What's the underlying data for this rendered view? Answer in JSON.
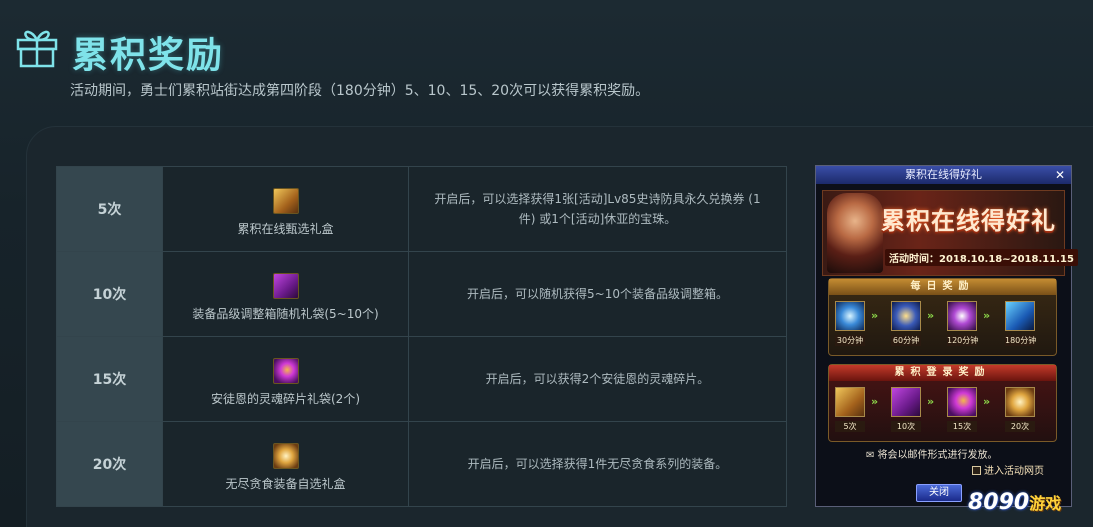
{
  "header": {
    "title": "累积奖励",
    "subtitle": "活动期间，勇士们累积站街达成第四阶段（180分钟）5、10、15、20次可以获得累积奖励。"
  },
  "rewards": [
    {
      "count": "5次",
      "item": "累积在线甄选礼盒",
      "desc": "开启后，可以选择获得1张[活动]Lv85史诗防具永久兑换券 (1件) 或1个[活动]休亚的宝珠。"
    },
    {
      "count": "10次",
      "item": "装备品级调整箱随机礼袋(5~10个)",
      "desc": "开启后，可以随机获得5~10个装备品级调整箱。"
    },
    {
      "count": "15次",
      "item": "安徒恩的灵魂碎片礼袋(2个)",
      "desc": "开启后，可以获得2个安徒恩的灵魂碎片。"
    },
    {
      "count": "20次",
      "item": "无尽贪食装备自选礼盒",
      "desc": "开启后，可以选择获得1件无尽贪食系列的装备。"
    }
  ],
  "popup": {
    "window_title": "累积在线得好礼",
    "close_glyph": "✕",
    "banner_title": "累积在线得好礼",
    "banner_date": "活动时间：2018.10.18~2018.11.15",
    "daily_head": "每日奖励",
    "daily_labels": [
      "30分钟",
      "60分钟",
      "120分钟",
      "180分钟"
    ],
    "cum_head": "累积登录奖励",
    "cum_labels": [
      "5次",
      "10次",
      "15次",
      "20次"
    ],
    "mail_text": "✉ 将会以邮件形式进行发放。",
    "enter_text": "进入活动网页",
    "close_button": "关闭"
  },
  "watermark": {
    "num": "8090",
    "cn": "游戏"
  }
}
